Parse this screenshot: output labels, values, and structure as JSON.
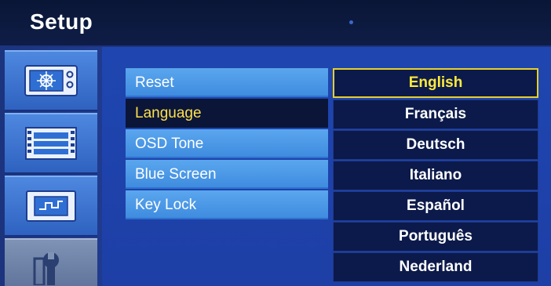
{
  "header": {
    "title": "Setup"
  },
  "sidebar": {
    "tabs": [
      {
        "icon": "picture-settings-icon"
      },
      {
        "icon": "film-strip-icon"
      },
      {
        "icon": "screen-chart-icon"
      },
      {
        "icon": "setup-tools-icon"
      }
    ]
  },
  "menu": {
    "items": [
      {
        "label": "Reset"
      },
      {
        "label": "Language"
      },
      {
        "label": "OSD Tone"
      },
      {
        "label": "Blue Screen"
      },
      {
        "label": "Key Lock"
      }
    ],
    "selected": "Language"
  },
  "languages": {
    "options": [
      "English",
      "Français",
      "Deutsch",
      "Italiano",
      "Español",
      "Português",
      "Nederland"
    ],
    "selected": "English"
  },
  "colors": {
    "accent_highlight": "#ffe04a",
    "menu_blue": "#4a96e6",
    "panel_blue": "#1f46b0",
    "dark_navy": "#0c1a4b"
  }
}
